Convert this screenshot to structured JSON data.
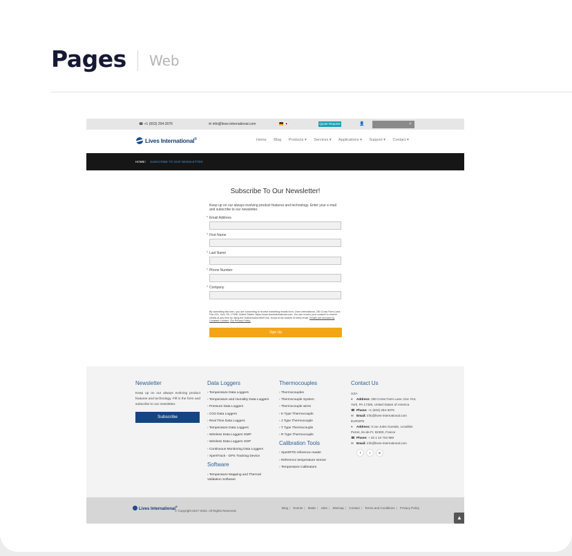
{
  "header": {
    "title": "Pages",
    "subtitle": "Web"
  },
  "topbar": {
    "phone": "+1 (603) 294-3076",
    "email": "info@lives-international.com",
    "flags": "🇩🇪 🇯🇵",
    "quote_label": "Quote Request"
  },
  "brand": {
    "name": "Lives International",
    "mark": "®"
  },
  "nav": {
    "items": [
      "Home",
      "Blog",
      "Products ▾",
      "Services ▾",
      "Applications ▾",
      "Support ▾",
      "Contact ▾"
    ]
  },
  "breadcrumb": {
    "home": "HOME",
    "separator": "/",
    "current": "SUBSCRIBE TO OUR NEWSLETTER"
  },
  "form": {
    "title": "Subscribe To Our Newsletter!",
    "intro": "Keep up on our always evolving product features and technology. Enter your e-mail and subscribe to our newsletter.",
    "required_mark": "*",
    "fields": [
      "Email Address",
      "First Name",
      "Last Name",
      "Phone Number",
      "Company"
    ],
    "consent": "By submitting this form, you are consenting to receive marketing emails from: Lives International, 250 Cross Farm Lane, Doc #13, York, PA, 17406, United States, https://www.livesinternational.com. You can revoke your consent to receive emails at any time by using the SafeUnsubscribe® link, found at the bottom of every email.",
    "consent_link1": "Emails are serviced by Constant Contact.",
    "consent_link2": "Our Privacy Policy.",
    "submit_label": "Sign Up"
  },
  "footer": {
    "newsletter": {
      "heading": "Newsletter",
      "text": "Keep up on our always evolving product features and technology. Fill in the form and subscribe to our newsletter.",
      "button": "Subscribe"
    },
    "data_loggers": {
      "heading": "Data Loggers",
      "links": [
        "Temperature Data Loggers",
        "Temperature and Humidity Data Loggers",
        "Pressure Data Loggers",
        "CO2 Data Loggers",
        "Real Time Data Loggers",
        "Temperature Data Loggers",
        "Wireless Data Loggers GMP",
        "Wireless Data Loggers GDP",
        "Continuous Monitoring Data Loggers",
        "XpertTrack - GPS Tracking Device"
      ]
    },
    "software": {
      "heading": "Software",
      "links": [
        "Temperature Mapping and Thermal Validation Software"
      ]
    },
    "thermocouples": {
      "heading": "Thermocouples",
      "links": [
        "Thermocouples",
        "Thermocouple System",
        "Thermocouple wires",
        "K Type Thermocouple",
        "J Type Thermocouple",
        "T Type Thermocouple",
        "R Type Thermocouple"
      ]
    },
    "calibration": {
      "heading": "Calibration Tools",
      "links": [
        "XpertRTD reference reader",
        "Reference temperature sensor",
        "Temperature Calibrators"
      ]
    },
    "contact": {
      "heading": "Contact Us",
      "usa": "USA",
      "usa_address_label": "Address:",
      "usa_address": "250 Cross Farm Lane, Doc #13, York, PA 17406, United States of America",
      "usa_phone_label": "Phone:",
      "usa_phone": "+1 (603) 294-3076",
      "usa_email_label": "Email:",
      "usa_email": "info@lives-international.com",
      "europe": "EUROPE",
      "eu_address_label": "Address:",
      "eu_address": "3 rue Jules Guesde, Levallois Perret, Ile-de-Fr, 92300, France",
      "eu_phone_label": "Phone:",
      "eu_phone": "+ 33 1 42 704 989",
      "eu_email_label": "Email:",
      "eu_email": "info@lives-international.com",
      "social": [
        "f",
        "t",
        "in"
      ]
    }
  },
  "bottom": {
    "copyright": "© Copyright 2017-2022, All Rights Reserved.",
    "links": [
      "Blog",
      "Events",
      "Made",
      "Jobs",
      "Sitemap",
      "Contact",
      "Terms and Conditions",
      "Privacy Policy"
    ],
    "back_to_top": "▲"
  }
}
